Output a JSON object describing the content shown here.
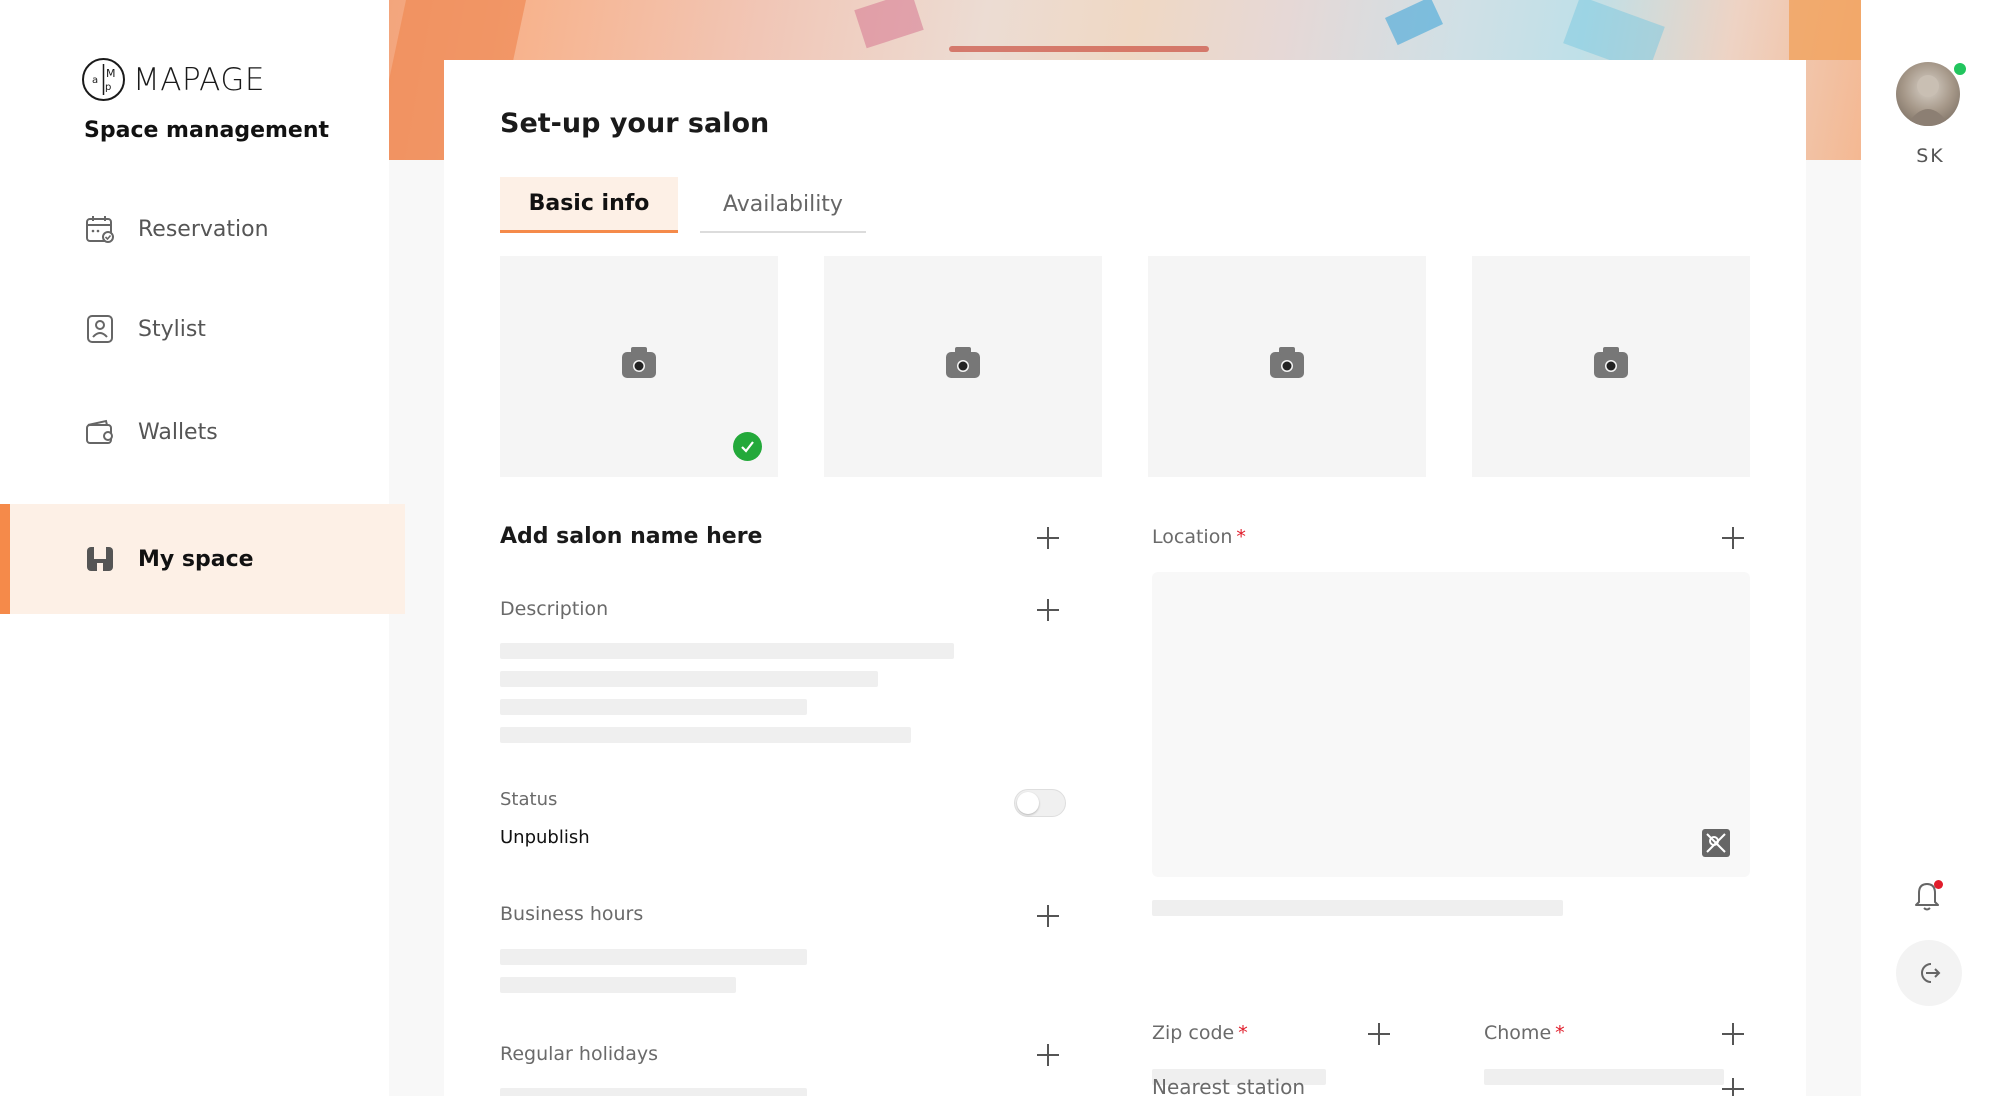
{
  "brand": {
    "logo_text": "MAPAGE",
    "subtitle": "Space management"
  },
  "sidebar": {
    "items": [
      {
        "label": "Reservation",
        "icon": "calendar-icon",
        "active": false
      },
      {
        "label": "Stylist",
        "icon": "stylist-badge-icon",
        "active": false
      },
      {
        "label": "Wallets",
        "icon": "wallet-icon",
        "active": false
      },
      {
        "label": "My space",
        "icon": "store-icon",
        "active": true
      }
    ]
  },
  "user": {
    "initials": "SK",
    "online": true
  },
  "colors": {
    "accent": "#f58a4a",
    "accent_bg": "#fdf0e6",
    "required": "#e11d2b",
    "success": "#23a93a",
    "online": "#22c55e"
  },
  "page": {
    "title": "Set-up your salon"
  },
  "tabs": [
    {
      "label": "Basic info",
      "active": true
    },
    {
      "label": "Availability",
      "active": false
    }
  ],
  "photos": {
    "count": 4,
    "icon": "camera-icon",
    "first_selected": true
  },
  "form": {
    "salon_name": "Add salon name here",
    "description_label": "Description",
    "status_label": "Status",
    "status_value": "Unpublish",
    "status_enabled": false,
    "business_hours_label": "Business hours",
    "regular_holidays_label": "Regular holidays",
    "location_label": "Location",
    "zip_label": "Zip code",
    "chome_label": "Chome",
    "nearest_station_label": "Nearest station",
    "required_mark": "*"
  }
}
